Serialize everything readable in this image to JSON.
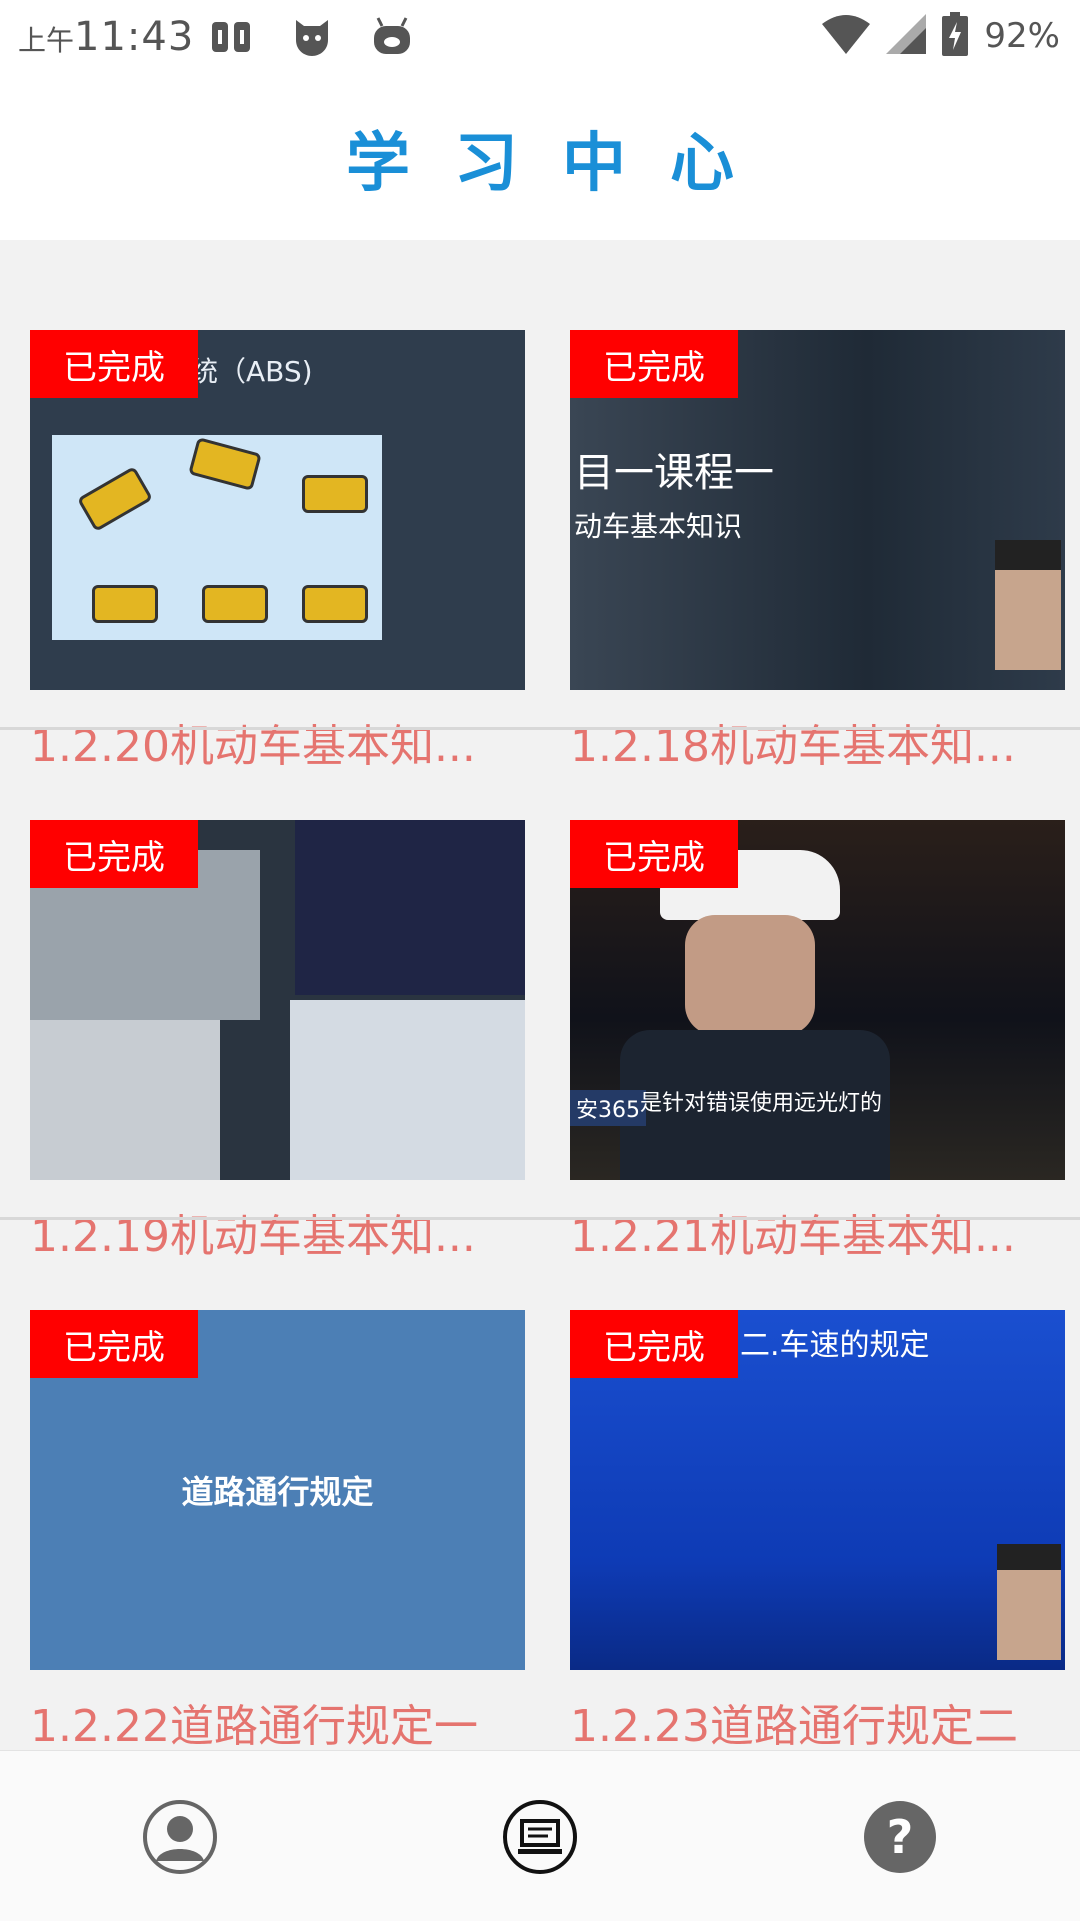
{
  "status_bar": {
    "am_pm": "上午",
    "time": "11:43",
    "battery": "92%",
    "left_icons": [
      "weibo-icon",
      "shield-cat-icon",
      "robot-face-icon"
    ],
    "right_icons": [
      "wifi-icon",
      "signal-icon",
      "battery-charging-icon"
    ]
  },
  "header": {
    "title": "学习中心"
  },
  "courses": [
    {
      "badge": "已完成",
      "title": "1.2.20机动车基本知...",
      "thumb_text": "统（ABS)"
    },
    {
      "badge": "已完成",
      "title": "1.2.18机动车基本知...",
      "thumb_line1": "目一课程一",
      "thumb_line2": "动车基本知识"
    },
    {
      "badge": "已完成",
      "title": "1.2.19机动车基本知..."
    },
    {
      "badge": "已完成",
      "title": "1.2.21机动车基本知...",
      "thumb_caption": "是针对错误使用远光灯的",
      "thumb_logo": "安365"
    },
    {
      "badge": "已完成",
      "title": "1.2.22道路通行规定一",
      "thumb_text": "道路通行规定"
    },
    {
      "badge": "已完成",
      "title": "1.2.23道路通行规定二",
      "thumb_heading": "二.车速的规定"
    }
  ],
  "bottom_nav": {
    "items": [
      {
        "icon": "profile-icon"
      },
      {
        "icon": "study-screen-icon"
      },
      {
        "icon": "help-icon"
      }
    ]
  }
}
